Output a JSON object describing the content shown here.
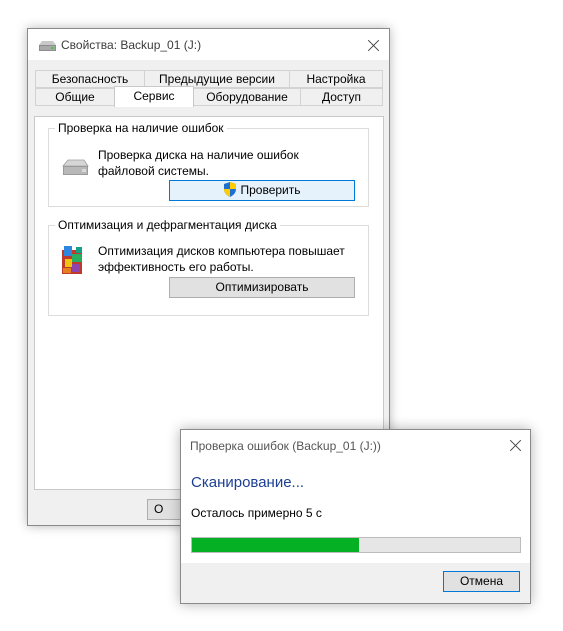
{
  "properties_window": {
    "title": "Свойства: Backup_01 (J:)",
    "tabs_back_row": [
      "Безопасность",
      "Предыдущие версии",
      "Настройка"
    ],
    "tabs_front_row": [
      "Общие",
      "Сервис",
      "Оборудование",
      "Доступ"
    ],
    "active_tab": "Сервис",
    "error_check": {
      "title": "Проверка на наличие ошибок",
      "description": "Проверка диска на наличие ошибок файловой системы.",
      "button": "Проверить",
      "icon": "drive-icon"
    },
    "optimize": {
      "title": "Оптимизация и дефрагментация диска",
      "description": "Оптимизация дисков компьютера повышает эффективность его работы.",
      "button": "Оптимизировать",
      "icon": "defrag-icon"
    },
    "bottom_button_partial": "О"
  },
  "scan_dialog": {
    "title": "Проверка ошибок (Backup_01 (J:))",
    "heading": "Сканирование...",
    "remaining": "Осталось примерно 5 с",
    "progress": 0.51,
    "cancel": "Отмена"
  },
  "colors": {
    "progress_fill": "#06b025",
    "heading": "#1c3f94",
    "focus_border": "#0078d7"
  }
}
